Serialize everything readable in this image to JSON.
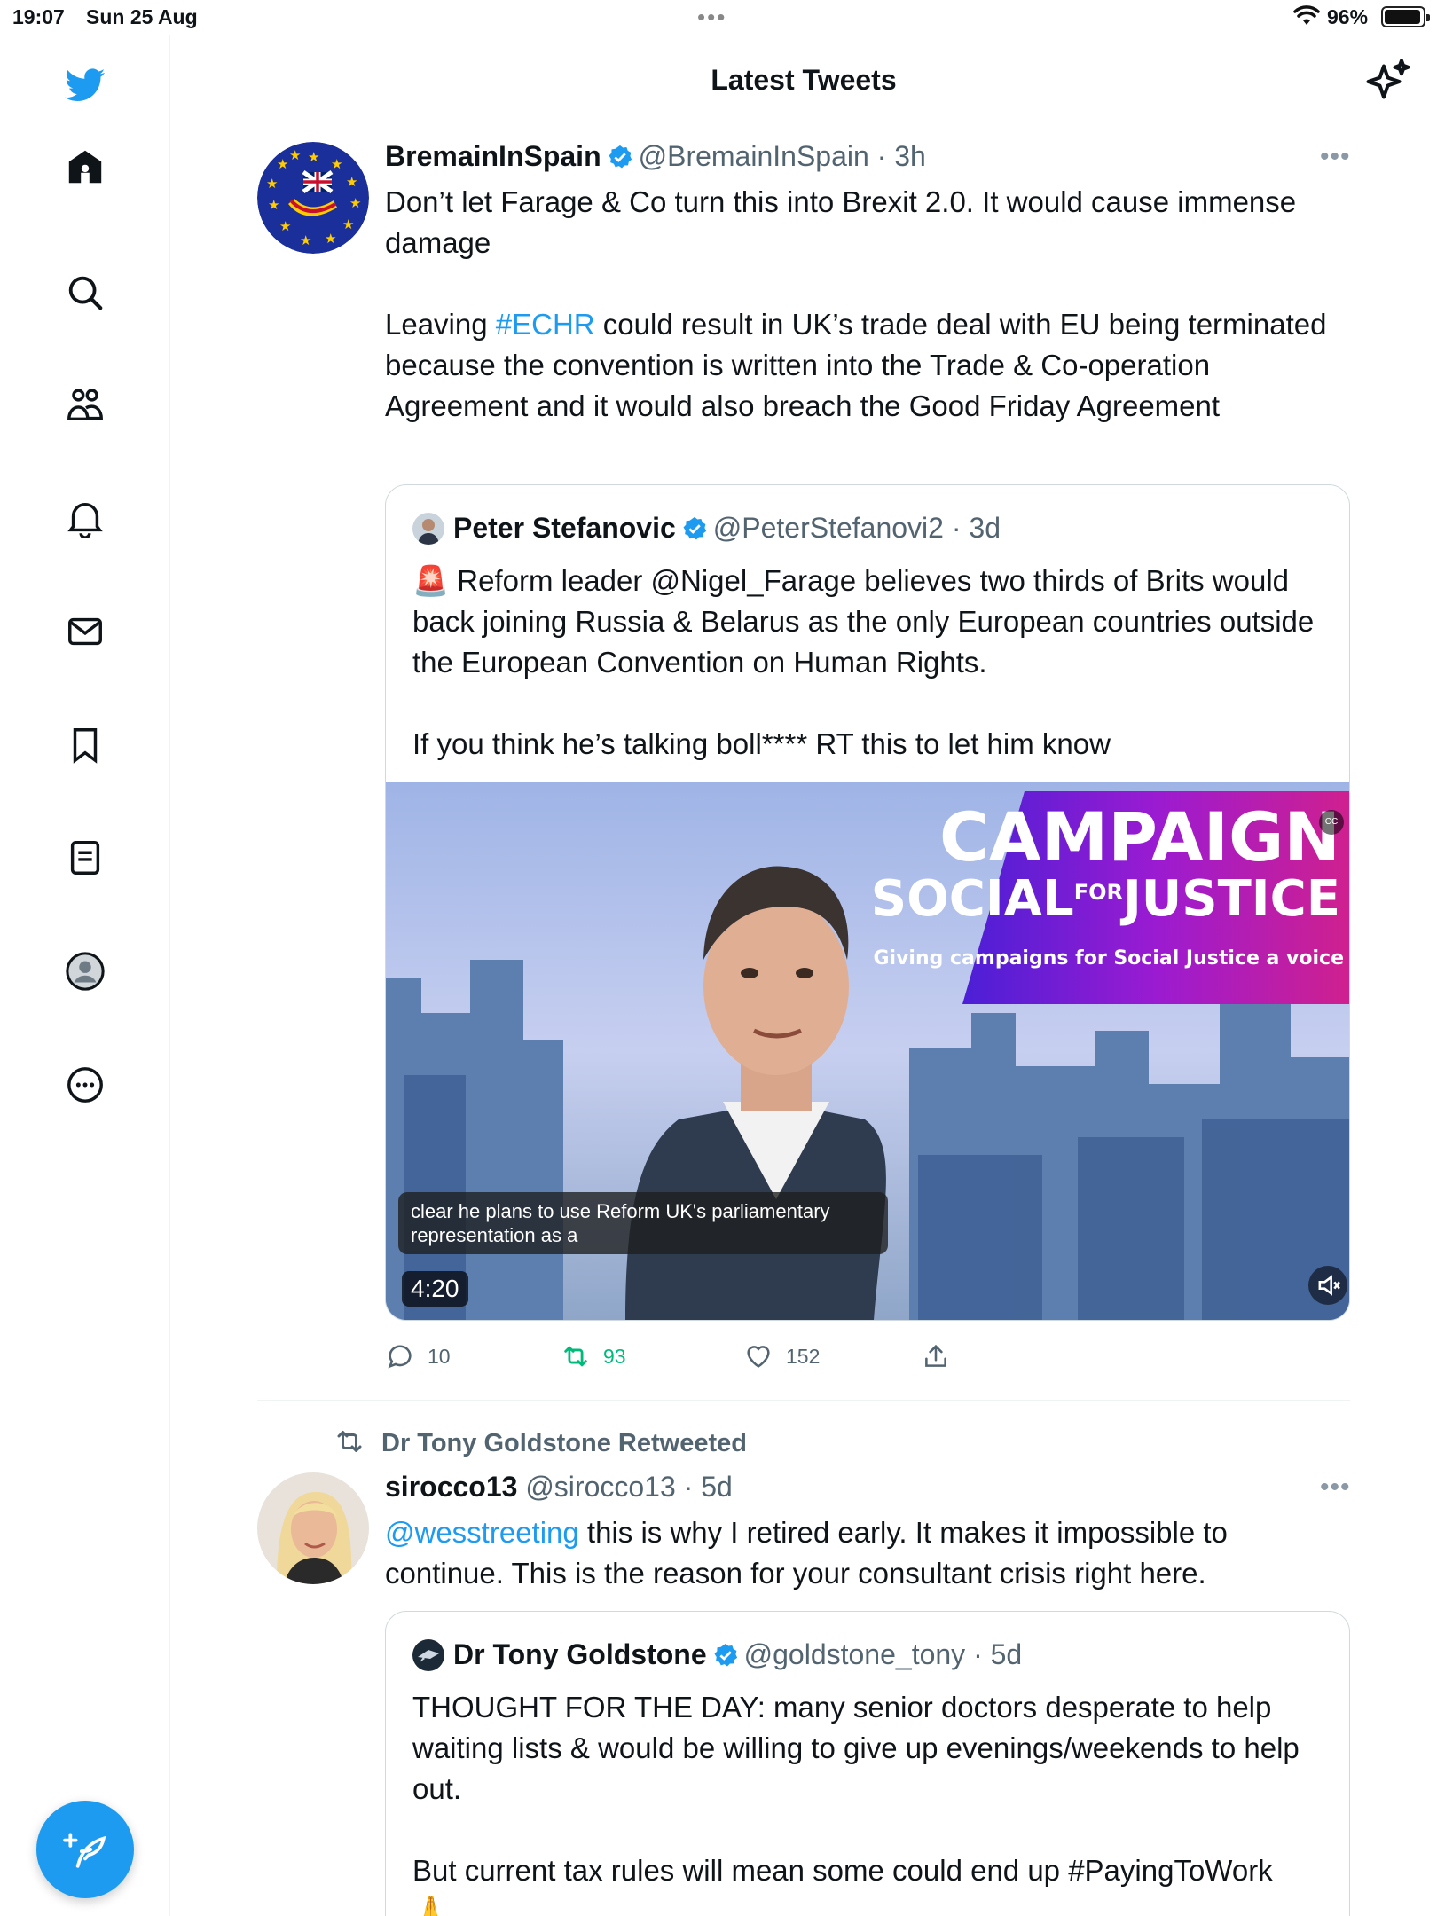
{
  "status_bar": {
    "time": "19:07",
    "date": "Sun 25 Aug",
    "battery": "96%",
    "battery_level": 0.96
  },
  "header": {
    "title": "Latest Tweets"
  },
  "sidebar": {
    "items": [
      "twitter-logo-icon",
      "home-icon",
      "search-icon",
      "communities-icon",
      "notifications-icon",
      "messages-icon",
      "bookmarks-icon",
      "lists-icon",
      "profile-icon",
      "more-icon"
    ],
    "compose_icon": "compose-tweet-icon"
  },
  "tweets": [
    {
      "name": "BremainInSpain",
      "handle": "@BremainInSpain",
      "time": "· 3h",
      "text_1": "Don’t let Farage & Co turn this into Brexit 2.0. It would cause immense damage",
      "text_2_pre": "Leaving ",
      "text_2_link": "#ECHR",
      "text_2_post": " could result in UK’s trade deal with EU being terminated because the convention is written into the Trade & Co-operation Agreement and it would also breach the Good Friday Agreement",
      "quote": {
        "name": "Peter Stefanovic",
        "handle": "@PeterStefanovi2",
        "time": "· 3d",
        "text_1": "🚨 Reform leader @Nigel_Farage believes two thirds of Brits would back joining Russia & Belarus as the only European countries outside the European Convention on Human Rights.",
        "text_2": "If you think he’s talking boll**** RT this to let him know",
        "video": {
          "banner_title_1": "CAMPAIGN",
          "banner_title_2a": "SOCIAL",
          "banner_title_2b": "FOR",
          "banner_title_2c": "JUSTICE",
          "banner_subtitle": "Giving campaigns for Social Justice a voice",
          "caption": "clear he plans to use Reform UK's parliamentary representation as a",
          "duration": "4:20",
          "cc_label": "CC"
        }
      },
      "replies": "10",
      "retweets": "93",
      "likes": "152"
    },
    {
      "retweeted_by": "Dr Tony Goldstone Retweeted",
      "name": "sirocco13",
      "handle": "@sirocco13",
      "time": "· 5d",
      "text_link": "@wesstreeting",
      "text_post": " this is why I retired early. It makes it impossible to continue. This is the reason for your consultant crisis right here.",
      "quote": {
        "name": "Dr Tony Goldstone",
        "handle": "@goldstone_tony",
        "time": "· 5d",
        "text_1": "THOUGHT FOR THE DAY: many senior doctors desperate to help waiting lists & would be willing to give up evenings/weekends to help out.",
        "text_2": "But current tax rules will mean some could end up #PayingToWork",
        "text_3": "🙏"
      }
    }
  ],
  "colors": {
    "accent": "#1d9bf0",
    "retweet_green": "#00ba7c",
    "muted_text": "#536471"
  }
}
